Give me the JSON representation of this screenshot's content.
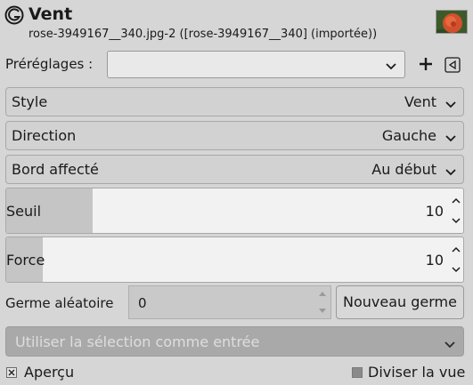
{
  "header": {
    "title": "Vent",
    "subtitle": "rose-3949167__340.jpg-2 ([rose-3949167__340] (importée))",
    "icon": "gimp-wilber-icon",
    "thumbnail": "rose-image-thumbnail"
  },
  "presets": {
    "label": "Préréglages :",
    "value": "",
    "add_icon": "plus-icon",
    "manage_icon": "menu-arrow-icon"
  },
  "style": {
    "label": "Style",
    "value": "Vent"
  },
  "direction": {
    "label": "Direction",
    "value": "Gauche"
  },
  "edge": {
    "label": "Bord affecté",
    "value": "Au début"
  },
  "threshold": {
    "label": "Seuil",
    "value": "10",
    "fill_fraction": 0.19
  },
  "strength": {
    "label": "Force",
    "value": "10",
    "fill_fraction": 0.08
  },
  "seed": {
    "label": "Germe aléatoire",
    "value": "0",
    "button_label": "Nouveau germe"
  },
  "selection": {
    "label": "Utiliser la sélection comme entrée",
    "disabled": true
  },
  "bottom": {
    "preview_label": "Aperçu",
    "preview_checked": true,
    "split_label": "Diviser la vue",
    "split_checked": false
  },
  "colors": {
    "background": "#d6d6d6",
    "disabled_combo": "#a9a9a9",
    "scale_fill": "#c5c5c5"
  }
}
